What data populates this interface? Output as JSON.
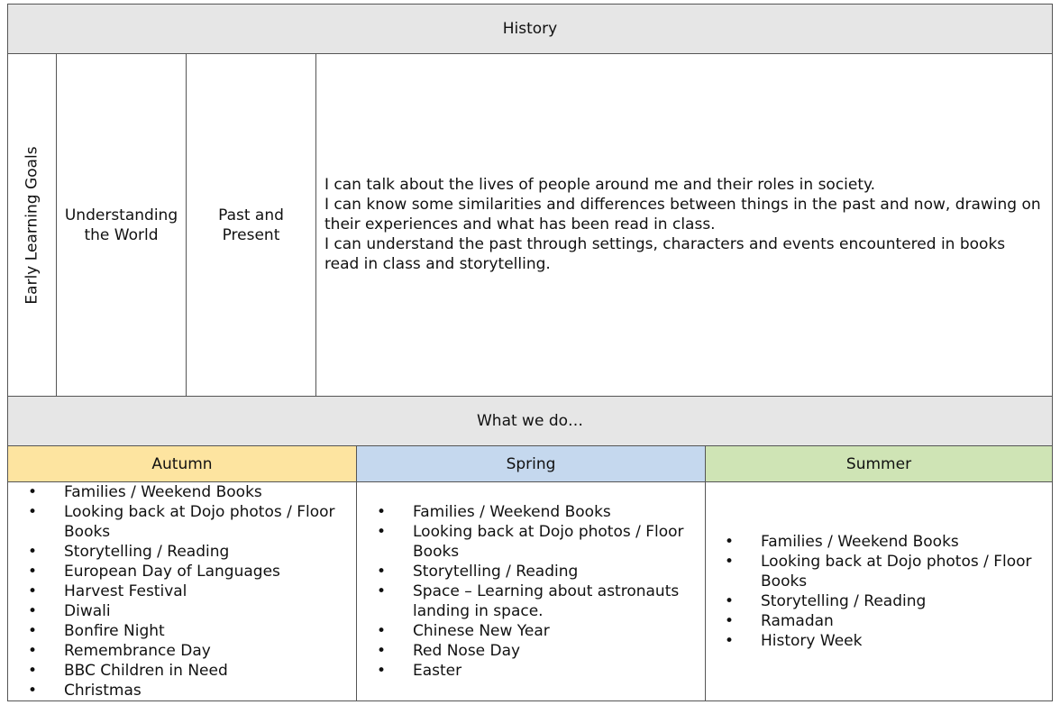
{
  "title": "History",
  "elg": {
    "row_label": "Early Learning Goals",
    "area": "Understanding the World",
    "strand": "Past and Present",
    "goals": [
      "I can talk about the lives of people around me and their roles in society.",
      "I can know some similarities and differences between things in the past and now, drawing on their experiences and what has been read in class.",
      "I can understand the past through settings, characters and events encountered in books read in class and storytelling."
    ]
  },
  "what_we_do": "What we do…",
  "colors": {
    "autumn": "#fde4a0",
    "spring": "#c5d8ee",
    "summer": "#cfe4b5",
    "header_gray": "#e6e6e6"
  },
  "seasons": [
    {
      "name": "Autumn",
      "items": [
        "Families / Weekend Books",
        "Looking back at Dojo photos / Floor Books",
        "Storytelling / Reading",
        "European Day of Languages",
        "Harvest Festival",
        "Diwali",
        "Bonfire Night",
        "Remembrance Day",
        "BBC Children in Need",
        "Christmas"
      ]
    },
    {
      "name": "Spring",
      "items": [
        "Families / Weekend Books",
        "Looking back at Dojo photos / Floor Books",
        "Storytelling / Reading",
        "Space – Learning about astronauts landing in space.",
        "Chinese New Year",
        "Red Nose Day",
        "Easter"
      ]
    },
    {
      "name": "Summer",
      "items": [
        "Families / Weekend Books",
        "Looking back at Dojo photos / Floor Books",
        "Storytelling / Reading",
        "Ramadan",
        "History Week"
      ]
    }
  ]
}
